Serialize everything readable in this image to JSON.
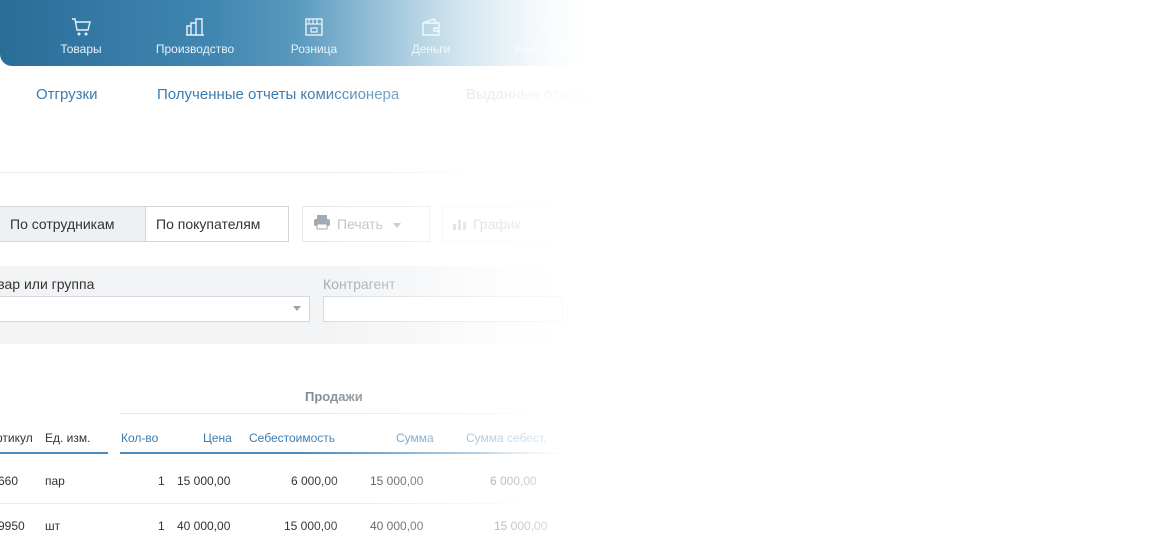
{
  "nav": {
    "items": [
      {
        "label": "Товары",
        "icon": "cart-icon"
      },
      {
        "label": "Производство",
        "icon": "factory-icon"
      },
      {
        "label": "Розница",
        "icon": "store-icon"
      },
      {
        "label": "Деньги",
        "icon": "wallet-icon"
      },
      {
        "label": "Контрагенты",
        "icon": "contacts-icon"
      }
    ]
  },
  "subtabs": [
    "Отгрузки",
    "Полученные отчеты комиссионера",
    "Выданные отчеты"
  ],
  "toolbar": {
    "by_employees": "По сотрудникам",
    "by_buyers": "По покупателям",
    "print": "Печать",
    "chart": "График"
  },
  "filters": {
    "product_label": "Товар или группа",
    "counterparty_label": "Контрагент",
    "product_value": "",
    "counterparty_value": ""
  },
  "table": {
    "group_header": "Продажи",
    "columns": [
      "Артикул",
      "Ед. изм.",
      "Кол-во",
      "Цена",
      "Себестоимость",
      "Сумма",
      "Сумма себест."
    ],
    "rows": [
      {
        "article": "660",
        "unit": "пар",
        "qty": "1",
        "price": "15 000,00",
        "cost": "6 000,00",
        "sum": "15 000,00",
        "cost_sum": "6 000,00"
      },
      {
        "article": "9950",
        "unit": "шт",
        "qty": "1",
        "price": "40 000,00",
        "cost": "15 000,00",
        "sum": "40 000,00",
        "cost_sum": "15 000,00"
      }
    ]
  },
  "colors": {
    "accent": "#3a7cb0",
    "nav_bg": "#2a6e98"
  }
}
